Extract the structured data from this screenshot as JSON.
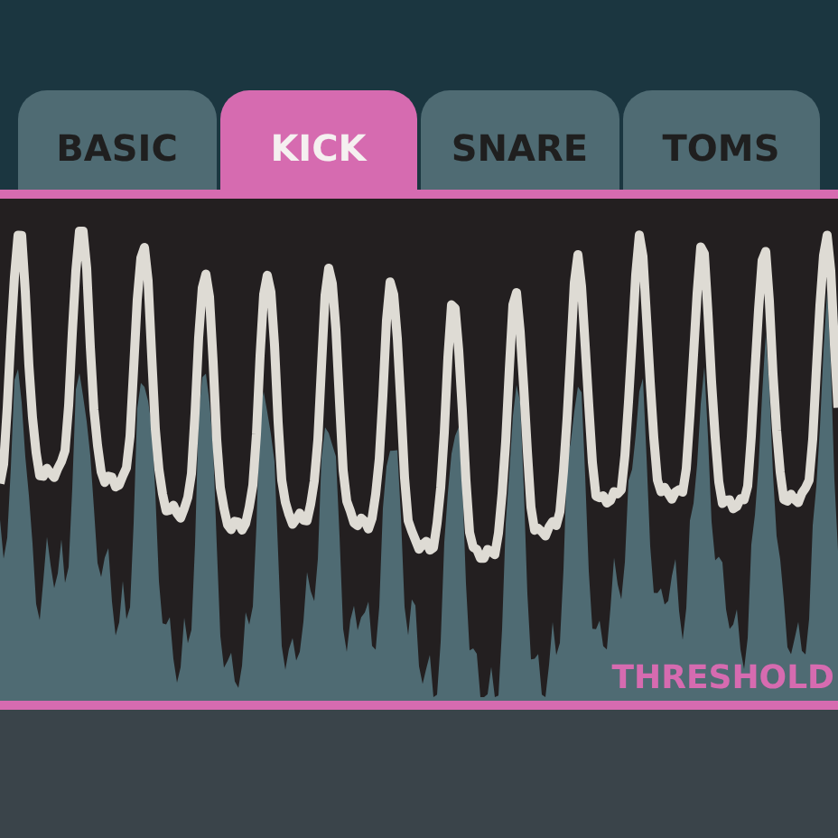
{
  "tabs": [
    {
      "label": "BASIC",
      "selected": false
    },
    {
      "label": "KICK",
      "selected": true
    },
    {
      "label": "SNARE",
      "selected": false
    },
    {
      "label": "TOMS",
      "selected": false
    }
  ],
  "display": {
    "threshold_label": "THRESHOLD"
  }
}
